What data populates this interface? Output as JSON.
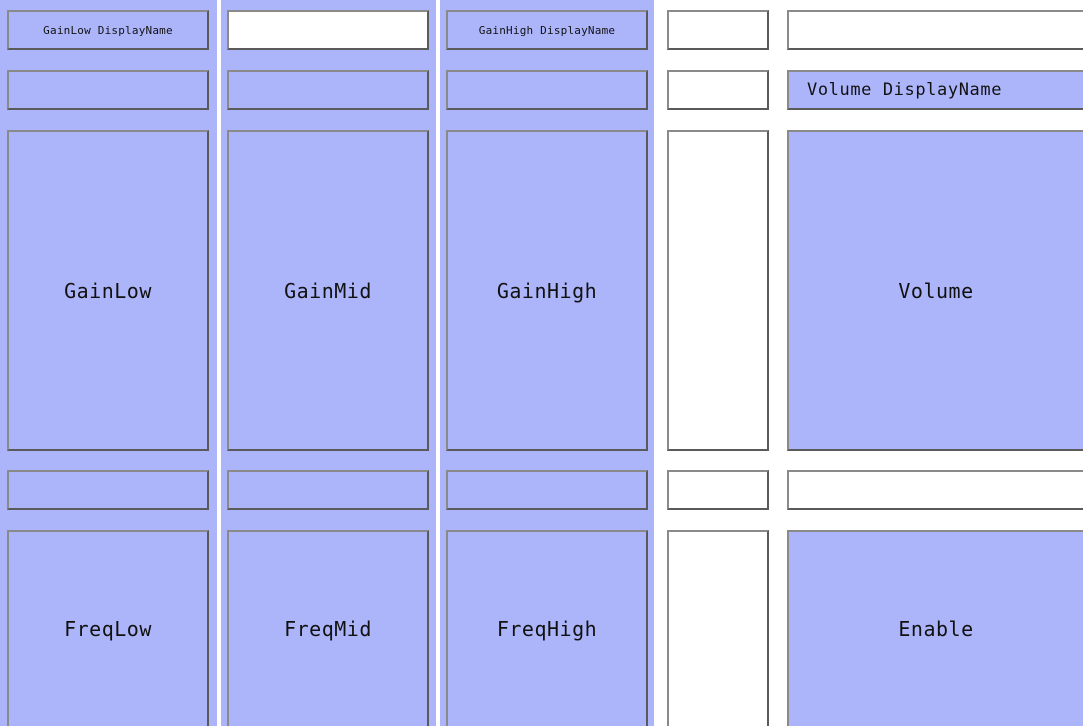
{
  "panel": {
    "gain_low_display_name": "GainLow DisplayName",
    "gain_high_display_name": "GainHigh DisplayName",
    "volume_display_name": "Volume DisplayName",
    "knobs": {
      "gain_low": "GainLow",
      "gain_mid": "GainMid",
      "gain_high": "GainHigh",
      "volume": "Volume",
      "freq_low": "FreqLow",
      "freq_mid": "FreqMid",
      "freq_high": "FreqHigh",
      "enable": "Enable"
    }
  },
  "colors": {
    "control_fill": "#adb5fa",
    "empty_fill": "#ffffff",
    "border": "#7c7c7c"
  }
}
